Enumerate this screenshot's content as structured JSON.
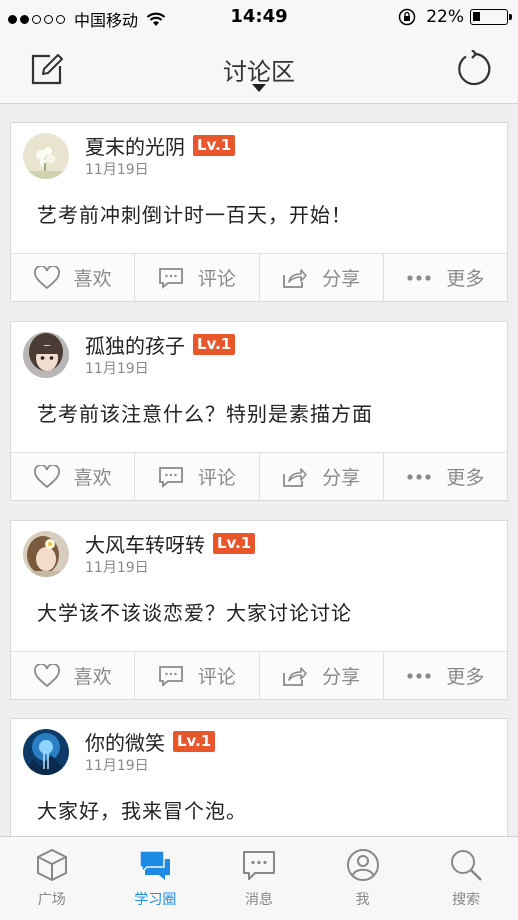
{
  "status_bar": {
    "carrier": "中国移动",
    "time": "14:49",
    "battery_text": "22%",
    "battery_level": 0.22
  },
  "nav": {
    "title": "讨论区"
  },
  "posts": [
    {
      "author": "夏末的光阴",
      "level": "Lv.1",
      "date": "11月19日",
      "content": "艺考前冲刺倒计时一百天，开始！",
      "actions": [
        "喜欢",
        "评论",
        "分享",
        "更多"
      ]
    },
    {
      "author": "孤独的孩子",
      "level": "Lv.1",
      "date": "11月19日",
      "content": "艺考前该注意什么？特别是素描方面",
      "actions": [
        "喜欢",
        "评论",
        "分享",
        "更多"
      ]
    },
    {
      "author": "大风车转呀转",
      "level": "Lv.1",
      "date": "11月19日",
      "content": "大学该不该谈恋爱？大家讨论讨论",
      "actions": [
        "喜欢",
        "评论",
        "分享",
        "更多"
      ]
    },
    {
      "author": "你的微笑",
      "level": "Lv.1",
      "date": "11月19日",
      "content": "大家好，我来冒个泡。",
      "actions": []
    }
  ],
  "tabs": [
    {
      "label": "广场",
      "icon": "cube-icon",
      "active": false
    },
    {
      "label": "学习圈",
      "icon": "chat-bubbles-icon",
      "active": true
    },
    {
      "label": "消息",
      "icon": "message-icon",
      "active": false
    },
    {
      "label": "我",
      "icon": "profile-icon",
      "active": false
    },
    {
      "label": "搜索",
      "icon": "search-icon",
      "active": false
    }
  ],
  "colors": {
    "accent": "#1d8be6",
    "badge": "#e8572c"
  }
}
